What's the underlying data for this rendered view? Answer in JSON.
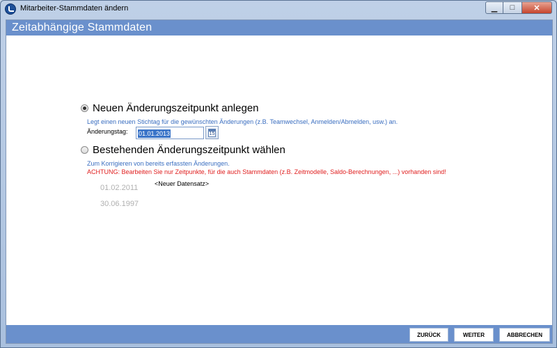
{
  "window": {
    "title": "Mitarbeiter-Stammdaten ändern",
    "minimize_glyph": "▁",
    "maximize_glyph": "□",
    "close_glyph": "✕"
  },
  "header": {
    "title": "Zeitabhängige Stammdaten"
  },
  "option_new": {
    "label": "Neuen Änderungszeitpunkt anlegen",
    "hint": "Legt einen neuen Stichtag für die gewünschten Änderungen (z.B. Teamwechsel, Anmelden/Abmelden, usw.) an.",
    "date_label": "Änderungstag:",
    "date_value": "01.01.2013",
    "calendar_day": "15",
    "selected": true
  },
  "option_existing": {
    "label": "Bestehenden Änderungszeitpunkt wählen",
    "hint": "Zum Korrigieren von bereits erfassten Änderungen.",
    "warning": "ACHTUNG: Bearbeiten Sie nur Zeitpunkte, für die auch Stammdaten (z.B. Zeitmodelle, Saldo-Berechnungen, ...) vorhanden sind!",
    "selected": false,
    "new_record_label": "<Neuer Datensatz>",
    "dates": [
      "01.02.2011",
      "30.06.1997"
    ]
  },
  "footer": {
    "back_label": "ZURÜCK",
    "next_label": "WEITER",
    "cancel_label": "ABBRECHEN"
  },
  "colors": {
    "header_bar": "#6a90cc",
    "hint_blue": "#3a6ec0",
    "warning_red": "#e02020",
    "disabled_gray": "#b0b0b0"
  }
}
